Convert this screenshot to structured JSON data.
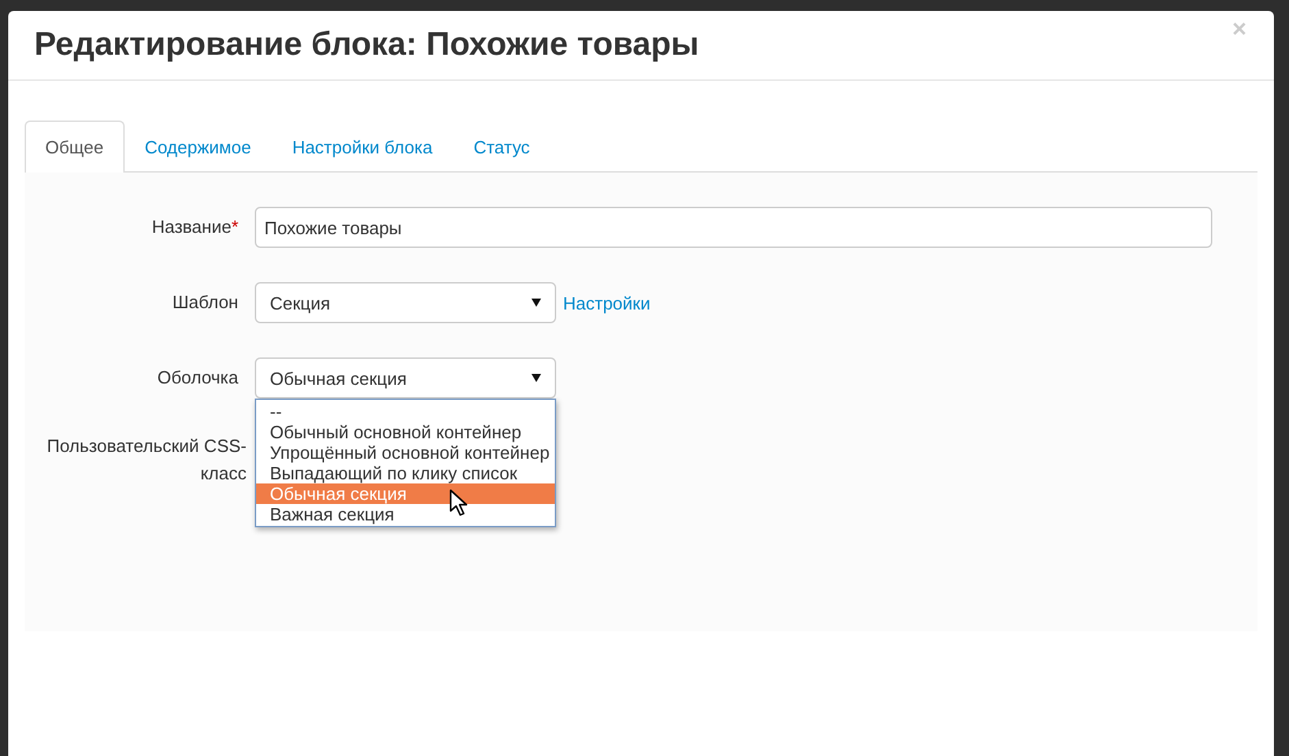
{
  "dialog": {
    "title": "Редактирование блока: Похожие товары",
    "close": "×"
  },
  "tabs": [
    {
      "label": "Общее",
      "selected": true
    },
    {
      "label": "Содержимое",
      "selected": false
    },
    {
      "label": "Настройки блока",
      "selected": false
    },
    {
      "label": "Статус",
      "selected": false
    }
  ],
  "fields": [
    {
      "kind": "text",
      "label": "Название",
      "required_mark": "*",
      "value": "Похожие товары"
    },
    {
      "kind": "select",
      "label": "Шаблон",
      "value": "Секция",
      "link": "Настройки"
    },
    {
      "kind": "select",
      "label": "Оболочка",
      "value": "Обычная секция",
      "expanded": true,
      "options": [
        {
          "label": "--",
          "selected": false
        },
        {
          "label": "Обычный основной контейнер",
          "selected": false
        },
        {
          "label": "Упрощённый основной контейнер",
          "selected": false
        },
        {
          "label": "Выпадающий по клику список",
          "selected": false
        },
        {
          "label": "Обычная секция",
          "selected": true
        },
        {
          "label": "Важная секция",
          "selected": false
        }
      ]
    },
    {
      "kind": "label",
      "label": "Пользовательский CSS-класс"
    }
  ]
}
